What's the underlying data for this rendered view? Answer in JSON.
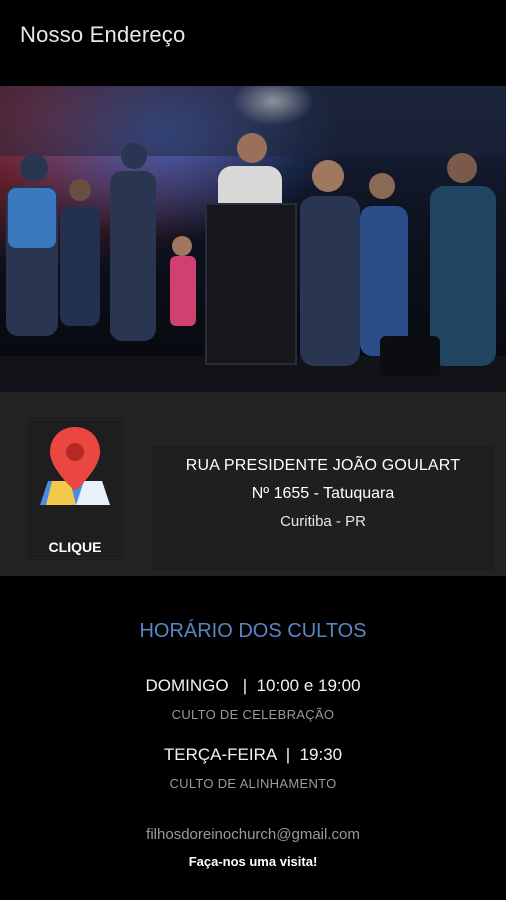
{
  "app_bar": {
    "title": "Nosso Endereço"
  },
  "hero": {
    "image": "church-stage-photo"
  },
  "map_button": {
    "icon": "map-pin-icon",
    "label": "CLIQUE"
  },
  "address": {
    "line1": "RUA PRESIDENTE JOÃO GOULART",
    "line2": "Nº 1655 - Tatuquara",
    "line3": "Curitiba - PR"
  },
  "services": {
    "heading": "HORÁRIO DOS CULTOS",
    "items": [
      {
        "schedule": "DOMINGO   |  10:00 e 19:00",
        "name": "CULTO DE CELEBRAÇÃO"
      },
      {
        "schedule": "TERÇA-FEIRA  |  19:30",
        "name": "CULTO DE ALINHAMENTO"
      }
    ]
  },
  "contact": {
    "email": "filhosdoreinochurch@gmail.com",
    "invite": "Faça-nos uma visita!"
  },
  "colors": {
    "heading": "#5b86c5",
    "band": "#232323",
    "pin": "#e9473f"
  }
}
